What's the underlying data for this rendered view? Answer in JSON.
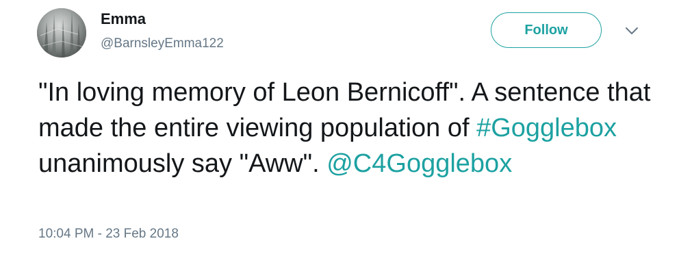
{
  "user": {
    "name": "Emma",
    "handle": "@BarnsleyEmma122",
    "avatar_icon": "profile-photo"
  },
  "actions": {
    "follow_label": "Follow",
    "more_icon": "chevron-down-icon"
  },
  "tweet": {
    "text_part1": "\"In loving memory of Leon Bernicoff\". A sentence that made the entire viewing population of ",
    "hashtag": "#Gogglebox",
    "text_part2": " unanimously say \"Aww\". ",
    "mention": "@C4Gogglebox",
    "timestamp": "10:04 PM - 23 Feb 2018"
  },
  "colors": {
    "accent": "#1da1a1",
    "text": "#14171a",
    "secondary": "#657786"
  }
}
